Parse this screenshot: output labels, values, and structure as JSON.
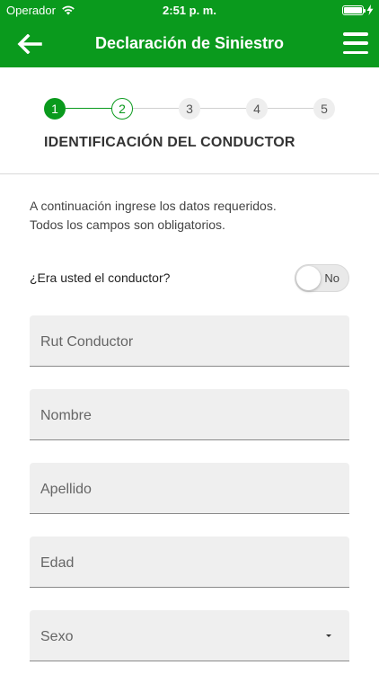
{
  "status_bar": {
    "carrier": "Operador",
    "time": "2:51 p. m."
  },
  "nav": {
    "title": "Declaración de Siniestro",
    "back_icon": "arrow-left-icon",
    "menu_icon": "hamburger-menu-icon"
  },
  "stepper": {
    "steps": [
      "1",
      "2",
      "3",
      "4",
      "5"
    ],
    "current": 1,
    "section_title": "IDENTIFICACIÓN DEL CONDUCTOR"
  },
  "intro": {
    "line1": "A continuación ingrese los datos requeridos.",
    "line2": "Todos los campos son obligatorios."
  },
  "driver_toggle": {
    "label": "¿Era usted el conductor?",
    "value": "No"
  },
  "fields": {
    "rut": "Rut Conductor",
    "nombre": "Nombre",
    "apellido": "Apellido",
    "edad": "Edad",
    "sexo": "Sexo"
  },
  "colors": {
    "brand_green": "#0a9a1d"
  }
}
